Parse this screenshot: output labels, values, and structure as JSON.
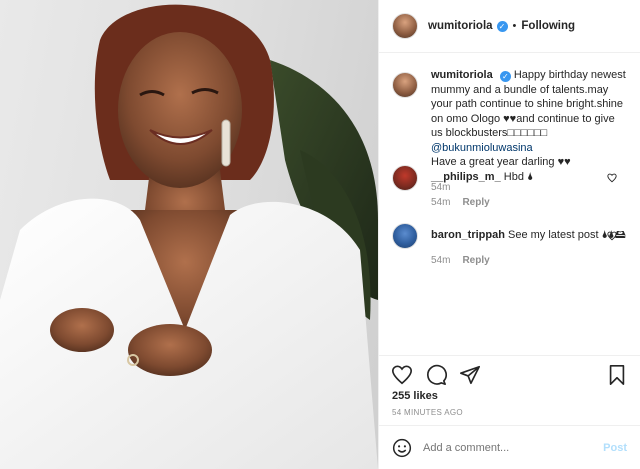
{
  "post": {
    "username": "wumitoriola",
    "following_label": "Following",
    "dot": "•",
    "caption_parts": {
      "text_a": "Happy birthday newest mummy and a bundle of talents.may your path continue to shine bright.shine on omo Ologo ♥♥and continue to give us blockbusters□□□□□□",
      "mention": "@bukunmioluwasina",
      "text_b": "Have a great year darling ♥♥"
    },
    "caption_time": "54m"
  },
  "comments": [
    {
      "username": "__philips_m_",
      "text": "Hbd 🌢",
      "time": "54m",
      "reply_label": "Reply"
    },
    {
      "username": "baron_trippah",
      "text": "See my latest post 🌢🌢🖴",
      "time": "54m",
      "reply_label": "Reply"
    }
  ],
  "stats": {
    "likes": "255 likes",
    "time_ago": "54 MINUTES AGO"
  },
  "composer": {
    "placeholder": "Add a comment...",
    "post_label": "Post"
  },
  "icons": {
    "like": "heart-icon",
    "comment": "comment-icon",
    "share": "share-icon",
    "save": "bookmark-icon",
    "emoji": "emoji-icon",
    "verified": "verified-badge-icon"
  },
  "colors": {
    "text": "#262626",
    "muted": "#8e8e8e",
    "link": "#00376b",
    "verified": "#3897f0",
    "post_disabled": "#b2dffc",
    "divider": "#efefef"
  }
}
